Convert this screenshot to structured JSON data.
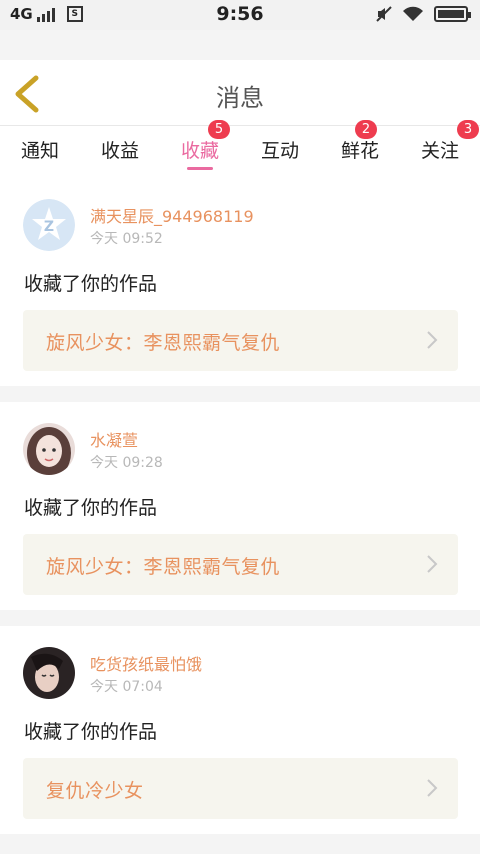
{
  "status_bar": {
    "network": "4G",
    "time": "9:56",
    "screenshot_icon": "S"
  },
  "header": {
    "title": "消息"
  },
  "tabs": [
    {
      "label": "通知",
      "badge": null,
      "active": false
    },
    {
      "label": "收益",
      "badge": null,
      "active": false
    },
    {
      "label": "收藏",
      "badge": "5",
      "active": true
    },
    {
      "label": "互动",
      "badge": null,
      "active": false
    },
    {
      "label": "鲜花",
      "badge": "2",
      "active": false
    },
    {
      "label": "关注",
      "badge": "3",
      "active": false
    }
  ],
  "notifications": [
    {
      "username": "满天星辰_944968119",
      "time": "今天 09:52",
      "action": "收藏了你的作品",
      "work": "旋风少女：李恩熙霸气复仇"
    },
    {
      "username": "水凝萱",
      "time": "今天 09:28",
      "action": "收藏了你的作品",
      "work": "旋风少女：李恩熙霸气复仇"
    },
    {
      "username": "吃货孩纸最怕饿",
      "time": "今天 07:04",
      "action": "收藏了你的作品",
      "work": "复仇冷少女"
    }
  ],
  "colors": {
    "accent_pink": "#ea6aa0",
    "badge_red": "#ee3c4f",
    "name_orange": "#e8925f",
    "link_bg": "#f6f5ee"
  }
}
